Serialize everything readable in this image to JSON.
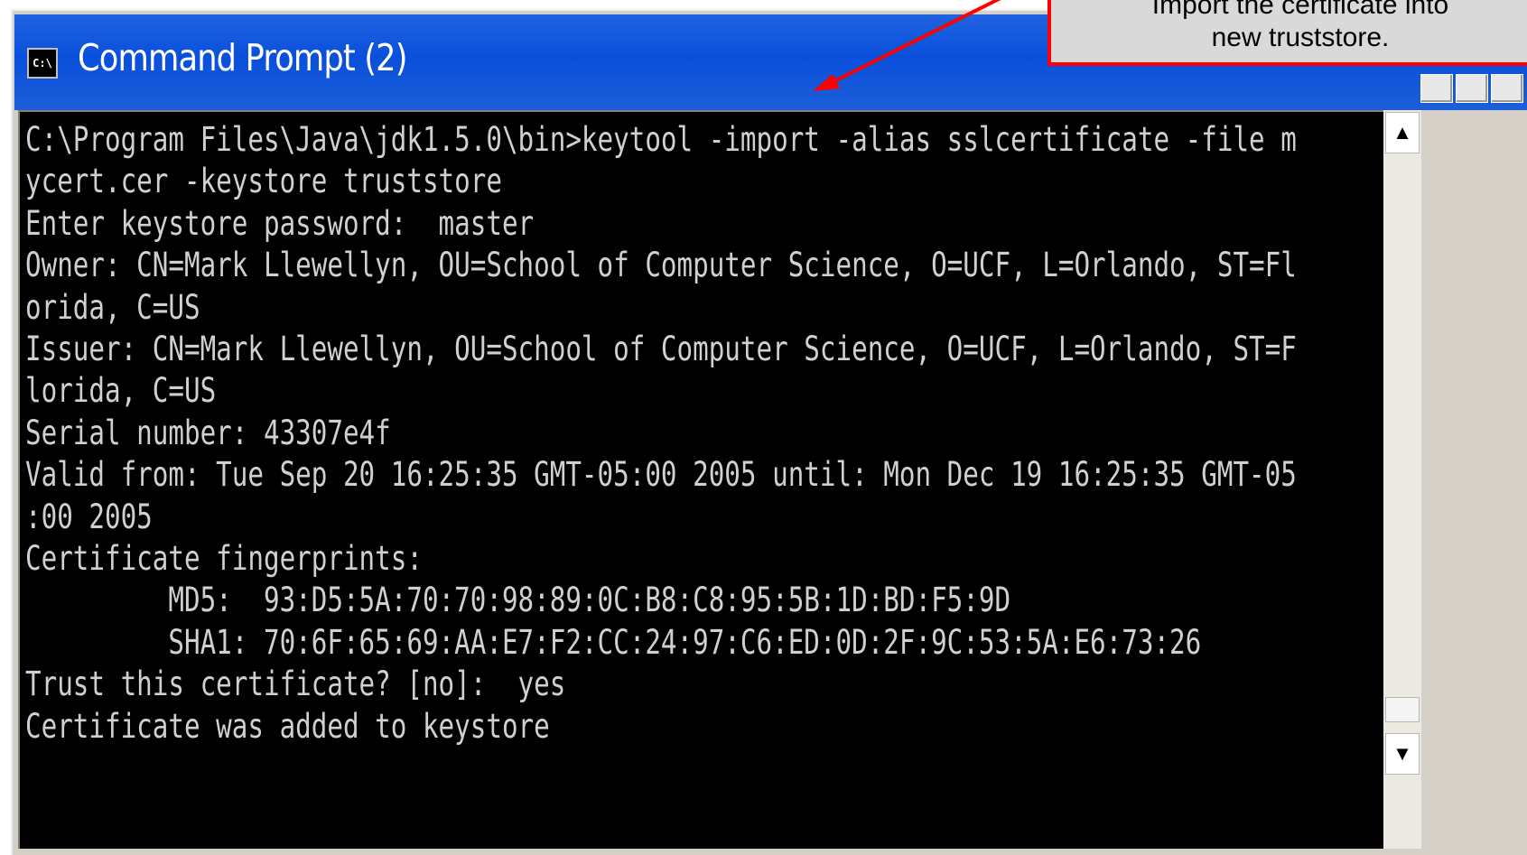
{
  "window": {
    "title": "Command Prompt (2)",
    "icon": "cmd-icon",
    "icon_text": "C:\\"
  },
  "console": {
    "lines": [
      "C:\\Program Files\\Java\\jdk1.5.0\\bin>keytool -import -alias sslcertificate -file m",
      "ycert.cer -keystore truststore",
      "Enter keystore password:  master",
      "Owner: CN=Mark Llewellyn, OU=School of Computer Science, O=UCF, L=Orlando, ST=Fl",
      "orida, C=US",
      "Issuer: CN=Mark Llewellyn, OU=School of Computer Science, O=UCF, L=Orlando, ST=F",
      "lorida, C=US",
      "Serial number: 43307e4f",
      "Valid from: Tue Sep 20 16:25:35 GMT-05:00 2005 until: Mon Dec 19 16:25:35 GMT-05",
      ":00 2005",
      "Certificate fingerprints:",
      "         MD5:  93:D5:5A:70:70:98:89:0C:B8:C8:95:5B:1D:BD:F5:9D",
      "         SHA1: 70:6F:65:69:AA:E7:F2:CC:24:97:C6:ED:0D:2F:9C:53:5A:E6:73:26",
      "Trust this certificate? [no]:  yes",
      "Certificate was added to keystore"
    ]
  },
  "callout": {
    "line1": "Import the certificate into",
    "line2": "new truststore."
  },
  "colors": {
    "titlebar": "#0a4fdc",
    "console_bg": "#000000",
    "console_text": "#d0d0d0",
    "callout_border": "#ff0000",
    "arrow": "#ff0000"
  }
}
